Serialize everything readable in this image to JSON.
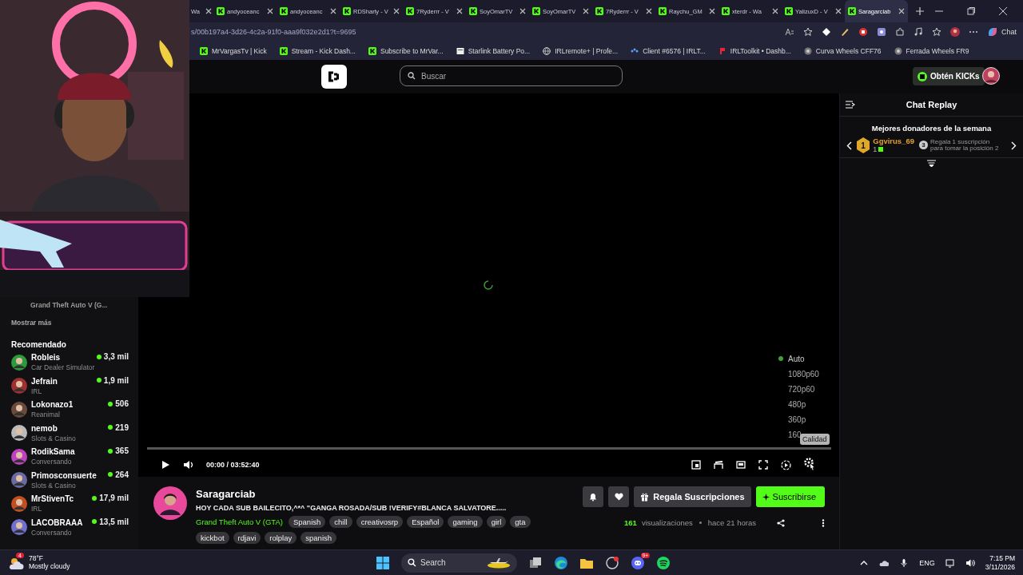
{
  "browser": {
    "tabs": [
      {
        "label": "Wa",
        "selected": false
      },
      {
        "label": "andyoceanc",
        "selected": false
      },
      {
        "label": "andyoceanc",
        "selected": false
      },
      {
        "label": "RDSharly - V",
        "selected": false
      },
      {
        "label": "7Ryderrr - V",
        "selected": false
      },
      {
        "label": "SoyOmarTV",
        "selected": false
      },
      {
        "label": "SoyOmarTV",
        "selected": false
      },
      {
        "label": "7Ryderrr - V",
        "selected": false
      },
      {
        "label": "Raychu_GM",
        "selected": false
      },
      {
        "label": "xterdr - Wa",
        "selected": false
      },
      {
        "label": "YalizuxD - V",
        "selected": false
      },
      {
        "label": "Saragarciab",
        "selected": true
      }
    ],
    "url": "s/00b197a4-3d26-4c2a-91f0-aaa9f032e2d1?t=9695",
    "chat_button": "Chat",
    "bookmarks": [
      {
        "label": "MrVargasTv | Kick",
        "kind": "kick"
      },
      {
        "label": "Stream - Kick Dash...",
        "kind": "kick"
      },
      {
        "label": "Subscribe to MrVar...",
        "kind": "kick"
      },
      {
        "label": "Starlink Battery Po...",
        "kind": "page"
      },
      {
        "label": "IRLremote+ | Profe...",
        "kind": "globe"
      },
      {
        "label": "Client #6576 | IRLT...",
        "kind": "dots"
      },
      {
        "label": "IRLToolkit • Dashb...",
        "kind": "red"
      },
      {
        "label": "Curva Wheels CFF76",
        "kind": "wheel"
      },
      {
        "label": "Ferrada Wheels FR9",
        "kind": "wheel"
      }
    ]
  },
  "header": {
    "search": {
      "placeholder": "Buscar"
    },
    "kicks_button": "Obtén KICKs"
  },
  "sidebar": {
    "partial_category": "Grand Theft Auto V (G...",
    "show_more": "Mostrar más",
    "section": "Recomendado",
    "channels": [
      {
        "name": "Robleis",
        "category": "Car Dealer Simulator",
        "viewers": "3,3 mil"
      },
      {
        "name": "Jefrain",
        "category": "IRL",
        "viewers": "1,9 mil"
      },
      {
        "name": "Lokonazo1",
        "category": "Reanimal",
        "viewers": "506"
      },
      {
        "name": "nemob",
        "category": "Slots & Casino",
        "viewers": "219"
      },
      {
        "name": "RodikSama",
        "category": "Conversando",
        "viewers": "365"
      },
      {
        "name": "Primosconsuerte",
        "category": "Slots & Casino",
        "viewers": "264"
      },
      {
        "name": "MrStivenTc",
        "category": "IRL",
        "viewers": "17,9 mil"
      },
      {
        "name": "LACOBRAAA",
        "category": "Conversando",
        "viewers": "13,5 mil"
      }
    ]
  },
  "player": {
    "quality_menu": [
      {
        "label": "Auto",
        "selected": true
      },
      {
        "label": "1080p60",
        "selected": false
      },
      {
        "label": "720p60",
        "selected": false
      },
      {
        "label": "480p",
        "selected": false
      },
      {
        "label": "360p",
        "selected": false
      },
      {
        "label": "160",
        "selected": false
      }
    ],
    "tooltip": "Calidad",
    "level": 0,
    "time": "00:00 / 03:52:40"
  },
  "stream": {
    "channel": "Saragarciab",
    "title": "HOY CADA SUB BAILECITO,^*^ \"GANGA ROSADA/SUB !VERIFY#BLANCA SALVATORE.....",
    "category": "Grand Theft Auto V (GTA)",
    "tags": [
      "Spanish",
      "chill",
      "creativosrp",
      "Español",
      "gaming",
      "girl",
      "gta",
      "kickbot",
      "rdjavi",
      "rolplay",
      "spanish"
    ],
    "gift_button": "Regala Suscripciones",
    "subscribe_button": "Suscribirse",
    "views_count": "161",
    "views_label": "visualizaciones",
    "age": "hace 21 horas"
  },
  "chat": {
    "title": "Chat Replay",
    "leaderboard_title": "Mejores donadores de la semana",
    "top_donor": {
      "rank": "1",
      "name": "Ggvirus_69",
      "count": "1"
    },
    "next_rank": "3",
    "next_text": "Regala 1 suscripción para tomar la posición 2"
  },
  "taskbar": {
    "weather_badge": "4",
    "temperature": "78°F",
    "condition": "Mostly cloudy",
    "search": {
      "placeholder": "Search"
    },
    "discord_badge": "9+",
    "language": "ENG",
    "time": "7:15 PM",
    "date": "3/11/2026"
  }
}
